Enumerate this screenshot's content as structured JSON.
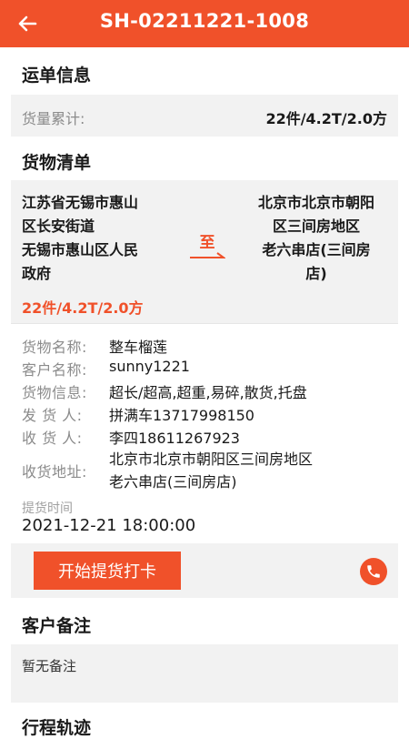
{
  "header": {
    "title": "SH-02211221-1008"
  },
  "waybill": {
    "section_title": "运单信息",
    "total_label": "货量累计:",
    "total_value": "22件/4.2T/2.0方"
  },
  "cargo_list": {
    "section_title": "货物清单",
    "origin_lines": [
      "江苏省无锡市惠山",
      "区长安街道",
      "无锡市惠山区人民",
      "政府"
    ],
    "to_label": "至",
    "dest_lines": [
      "北京市北京市朝阳",
      "区三间房地区",
      "老六串店(三间房",
      "店)"
    ],
    "summary": "22件/4.2T/2.0方"
  },
  "details": {
    "cargo_name_label": "货物名称:",
    "cargo_name_value": "整车榴莲",
    "customer_name_label": "客户名称:",
    "customer_name_value": "sunny1221",
    "cargo_info_label": "货物信息:",
    "cargo_info_value": "超长/超高,超重,易碎,散货,托盘",
    "shipper_label": "发 货 人:",
    "shipper_value": "拼满车13717998150",
    "receiver_label": "收 货 人:",
    "receiver_value": "李四18611267923",
    "address_label": "收货地址:",
    "address_lines": [
      "北京市北京市朝阳区三间房地区",
      "老六串店(三间房店)"
    ],
    "pickup_time_label": "提货时间",
    "pickup_time_value": "2021-12-21 18:00:00"
  },
  "actions": {
    "start_button": "开始提货打卡",
    "phone_icon": "phone-icon"
  },
  "remarks": {
    "section_title": "客户备注",
    "text": "暂无备注"
  },
  "next_section": {
    "section_title": "行程轨迹"
  },
  "colors": {
    "accent": "#f0512a",
    "gray_bg": "#f2f2f2"
  }
}
